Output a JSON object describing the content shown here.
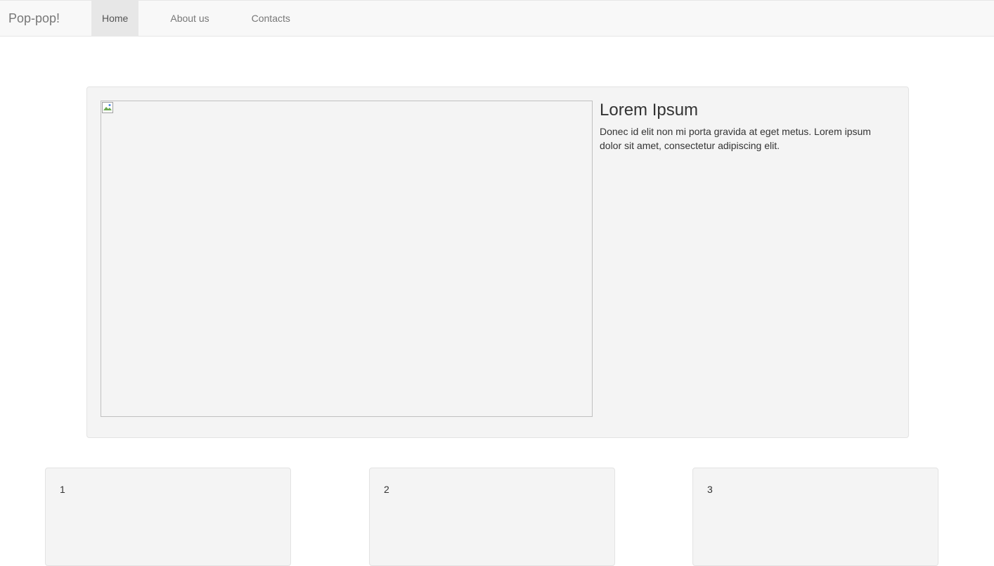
{
  "navbar": {
    "brand": "Pop-pop!",
    "links": [
      {
        "label": "Home",
        "active": true
      },
      {
        "label": "About us",
        "active": false
      },
      {
        "label": "Contacts",
        "active": false
      }
    ]
  },
  "hero": {
    "image_icon": "broken-image-icon",
    "title": "Lorem Ipsum",
    "body": "Donec id elit non mi porta gravida at eget metus. Lorem ipsum dolor sit amet, consectetur adipiscing elit."
  },
  "cards": [
    {
      "label": "1"
    },
    {
      "label": "2"
    },
    {
      "label": "3"
    }
  ],
  "colors": {
    "navbar_bg": "#f8f8f8",
    "active_tab_bg": "#e7e7e7",
    "panel_bg": "#f4f4f4",
    "text": "#333333",
    "nav_text": "#777777"
  }
}
